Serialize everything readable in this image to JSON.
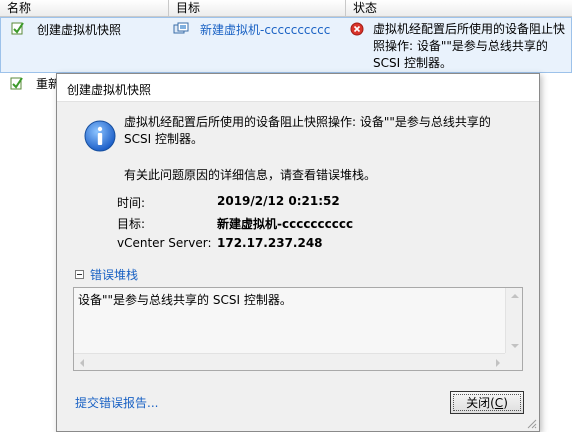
{
  "list": {
    "columns": [
      "名称",
      "目标",
      "状态"
    ],
    "row1": {
      "name": "创建虚拟机快照",
      "target": "新建虚拟机-cccccccccc",
      "status": "虚拟机经配置后所使用的设备阻止快照操作: 设备\"\"是参与总线共享的 SCSI 控制器。"
    },
    "row2": {
      "name_partial": "重新"
    }
  },
  "dialog": {
    "title": "创建虚拟机快照",
    "message": "虚拟机经配置后所使用的设备阻止快照操作: 设备\"\"是参与总线共享的 SCSI 控制器。",
    "hint": "有关此问题原因的详细信息，请查看错误堆栈。",
    "details": {
      "time_label": "时间:",
      "time_value": "2019/2/12 0:21:52",
      "target_label": "目标:",
      "target_value": "新建虚拟机-cccccccccc",
      "server_label": "vCenter Server:",
      "server_value": "172.17.237.248"
    },
    "stack": {
      "toggle_label": "错误堆栈",
      "text": "设备\"\"是参与总线共享的 SCSI 控制器。"
    },
    "report_link": "提交错误报告...",
    "close_button": {
      "label": "关闭(",
      "mnemonic": "C",
      "suffix": ")"
    }
  },
  "colors": {
    "link": "#1a62c4",
    "selected_row": "#e9f2fc",
    "error_icon": "#d9342b",
    "info_icon": "#2a6fd6"
  }
}
